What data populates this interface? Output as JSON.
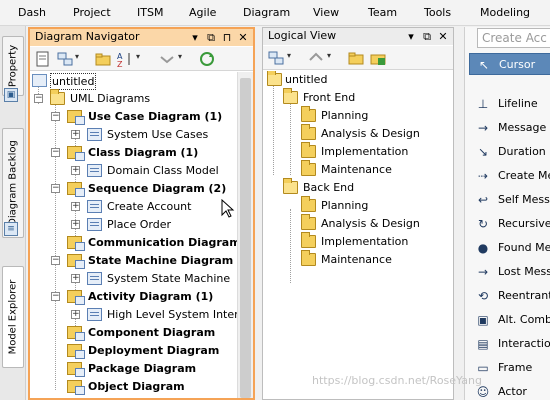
{
  "menubar": {
    "items": [
      "Dash",
      "Project",
      "ITSM",
      "Agile",
      "Diagram",
      "View",
      "Team",
      "Tools",
      "Modeling"
    ]
  },
  "side_tabs": [
    "Property",
    "Diagram Backlog",
    "Model Explorer"
  ],
  "navigator": {
    "title": "Diagram Navigator",
    "header_buttons": [
      "menu-icon",
      "restore-icon",
      "maximize-icon",
      "close-icon"
    ],
    "toolbar_icons": [
      "new-diagram-icon",
      "new-model-icon",
      "folder-icon",
      "sort-icon",
      "collapse-icon",
      "refresh-icon"
    ],
    "tree": [
      {
        "label": "untitled",
        "level": 0,
        "icon": "project-icon",
        "bold": false,
        "selected": true
      },
      {
        "label": "UML Diagrams",
        "level": 1,
        "icon": "folder-open-icon",
        "expanded": true
      },
      {
        "label": "Use Case Diagram (1)",
        "level": 2,
        "icon": "diagram-folder-icon",
        "bold": true,
        "expanded": true
      },
      {
        "label": "System Use Cases",
        "level": 3,
        "icon": "diagram-icon",
        "expander": "+"
      },
      {
        "label": "Class Diagram (1)",
        "level": 2,
        "icon": "diagram-folder-icon",
        "bold": true,
        "expanded": true
      },
      {
        "label": "Domain Class Model",
        "level": 3,
        "icon": "diagram-icon",
        "expander": "+"
      },
      {
        "label": "Sequence Diagram (2)",
        "level": 2,
        "icon": "diagram-folder-icon",
        "bold": true,
        "expanded": true
      },
      {
        "label": "Create Account",
        "level": 3,
        "icon": "diagram-icon",
        "expander": "+"
      },
      {
        "label": "Place Order",
        "level": 3,
        "icon": "diagram-icon",
        "expander": "+"
      },
      {
        "label": "Communication Diagram",
        "level": 2,
        "icon": "diagram-folder-icon",
        "bold": true
      },
      {
        "label": "State Machine Diagram (1)",
        "level": 2,
        "icon": "diagram-folder-icon",
        "bold": true,
        "expanded": true
      },
      {
        "label": "System State Machine",
        "level": 3,
        "icon": "diagram-icon",
        "expander": "+"
      },
      {
        "label": "Activity Diagram (1)",
        "level": 2,
        "icon": "diagram-folder-icon",
        "bold": true,
        "expanded": true
      },
      {
        "label": "High Level System Interacti",
        "level": 3,
        "icon": "diagram-icon",
        "expander": "+"
      },
      {
        "label": "Component Diagram",
        "level": 2,
        "icon": "diagram-folder-icon",
        "bold": true
      },
      {
        "label": "Deployment Diagram",
        "level": 2,
        "icon": "diagram-folder-icon",
        "bold": true
      },
      {
        "label": "Package Diagram",
        "level": 2,
        "icon": "diagram-folder-icon",
        "bold": true
      },
      {
        "label": "Object Diagram",
        "level": 2,
        "icon": "diagram-folder-icon",
        "bold": true
      }
    ]
  },
  "logical_view": {
    "title": "Logical View",
    "header_buttons": [
      "menu-icon",
      "restore-icon",
      "close-icon"
    ],
    "toolbar_icons": [
      "new-diagram-icon",
      "model-icon",
      "up-icon",
      "folder-icon",
      "add-folder-icon"
    ],
    "tree": [
      {
        "label": "untitled",
        "level": 0,
        "icon": "folder-open-icon"
      },
      {
        "label": "Front End",
        "level": 1,
        "icon": "folder-open-icon"
      },
      {
        "label": "Planning",
        "level": 2,
        "icon": "folder-icon"
      },
      {
        "label": "Analysis & Design",
        "level": 2,
        "icon": "folder-icon"
      },
      {
        "label": "Implementation",
        "level": 2,
        "icon": "folder-icon"
      },
      {
        "label": "Maintenance",
        "level": 2,
        "icon": "folder-icon"
      },
      {
        "label": "Back End",
        "level": 1,
        "icon": "folder-open-icon"
      },
      {
        "label": "Planning",
        "level": 2,
        "icon": "folder-icon"
      },
      {
        "label": "Analysis & Design",
        "level": 2,
        "icon": "folder-icon"
      },
      {
        "label": "Implementation",
        "level": 2,
        "icon": "folder-icon"
      },
      {
        "label": "Maintenance",
        "level": 2,
        "icon": "folder-icon"
      }
    ]
  },
  "palette": {
    "search_placeholder": "Create Acc",
    "items": [
      {
        "label": "Cursor",
        "icon": "cursor-icon",
        "glyph": "↖",
        "selected": true
      },
      {
        "label": "Lifeline",
        "icon": "lifeline-icon",
        "glyph": "⊥"
      },
      {
        "label": "Message",
        "icon": "message-arrow-icon",
        "glyph": "→"
      },
      {
        "label": "Duration Me",
        "icon": "duration-message-icon",
        "glyph": "↘"
      },
      {
        "label": "Create Mes",
        "icon": "create-message-icon",
        "glyph": "⇢"
      },
      {
        "label": "Self Messa",
        "icon": "self-message-icon",
        "glyph": "↩"
      },
      {
        "label": "Recursive",
        "icon": "recursive-message-icon",
        "glyph": "↻"
      },
      {
        "label": "Found Mes",
        "icon": "found-message-icon",
        "glyph": "●"
      },
      {
        "label": "Lost Messa",
        "icon": "lost-message-icon",
        "glyph": "→"
      },
      {
        "label": "Reentrant M",
        "icon": "reentrant-message-icon",
        "glyph": "⟲"
      },
      {
        "label": "Alt. Combin",
        "icon": "alt-combined-fragment-icon",
        "glyph": "▣"
      },
      {
        "label": "Interaction",
        "icon": "interaction-use-icon",
        "glyph": "▤"
      },
      {
        "label": "Frame",
        "icon": "frame-icon",
        "glyph": "▭"
      },
      {
        "label": "Actor",
        "icon": "actor-icon",
        "glyph": "☺"
      }
    ]
  },
  "watermark": "https://blog.csdn.net/RoseYang",
  "colors": {
    "active_panel_border": "#f5a356",
    "active_panel_header": "#fbd7a8",
    "palette_selected": "#5c88b8"
  }
}
